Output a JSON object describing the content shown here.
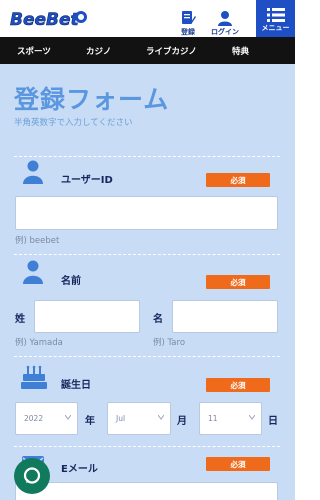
{
  "header": {
    "logo_text": "BeeBet",
    "register_label": "登録",
    "login_label": "ログイン",
    "menu_label": "メニュー"
  },
  "nav": {
    "items": [
      {
        "label": "スポーツ"
      },
      {
        "label": "カジノ"
      },
      {
        "label": "ライブカジノ"
      },
      {
        "label": "特典"
      }
    ]
  },
  "form": {
    "title": "登録フォーム",
    "subtitle": "半角英数字で入力してください",
    "required_label": "必須",
    "user_id": {
      "label": "ユーザーID",
      "value": "",
      "hint": "例) beebet"
    },
    "name": {
      "label": "名前",
      "last_label": "姓",
      "first_label": "名",
      "last_value": "",
      "first_value": "",
      "last_hint": "例) Yamada",
      "first_hint": "例) Taro"
    },
    "birthday": {
      "label": "誕生日",
      "year_value": "2022",
      "year_unit": "年",
      "month_value": "Jul",
      "month_unit": "月",
      "day_value": "11",
      "day_unit": "日"
    },
    "email": {
      "label": "Eメール",
      "value": ""
    }
  },
  "colors": {
    "brand_blue": "#1f4fc4",
    "form_bg": "#c9dcf5",
    "required_orange": "#f06a1c",
    "chat_green": "#127a5c"
  }
}
